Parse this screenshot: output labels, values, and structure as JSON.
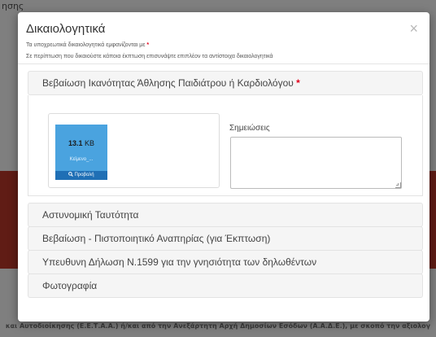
{
  "background": {
    "top_text": "ησης",
    "footer_text": "και Αυτοδιοίκησης (Ε.Ε.Τ.Α.Α.) ή/και από την Ανεξάρτητη Αρχή Δημοσίων Εσόδων (Α.Α.Δ.Ε.), με σκοπό την αξιολογ"
  },
  "modal": {
    "title": "Δικαιολογητικά",
    "close_label": "×",
    "subtitle_1": "Τα υποχρεωτικά δικαιολογητικά εμφανίζονται με",
    "required_marker": "*",
    "subtitle_2": "Σε περίπτωση που δικαιούστε κάποια έκπτωση επισυνάψτε επιπλέον τα αντίστοιχα δικαιολογητικά"
  },
  "documents": [
    {
      "label": "Βεβαίωση Ικανότητας Άθλησης Παιδιάτρου ή Καρδιολόγου",
      "required": "*",
      "expanded": true,
      "file": {
        "size_value": "13.1",
        "size_unit": "KB",
        "name": "Κείμενο_...",
        "preview_label": "Προβολή"
      },
      "notes_label": "Σημειώσεις",
      "notes_value": ""
    },
    {
      "label": "Αστυνομική Ταυτότητα"
    },
    {
      "label": "Βεβαίωση - Πιστοποιητικό Αναπηρίας (για Έκπτωση)"
    },
    {
      "label": "Υπευθυνη Δήλωση Ν.1599 για την γνησιότητα των δηλωθέντων"
    },
    {
      "label": "Φωτογραφία"
    }
  ],
  "colors": {
    "required": "#e2001a",
    "file_thumb": "#4aa3df",
    "preview_button": "#1f6fb5",
    "background_band": "#c0392b"
  }
}
